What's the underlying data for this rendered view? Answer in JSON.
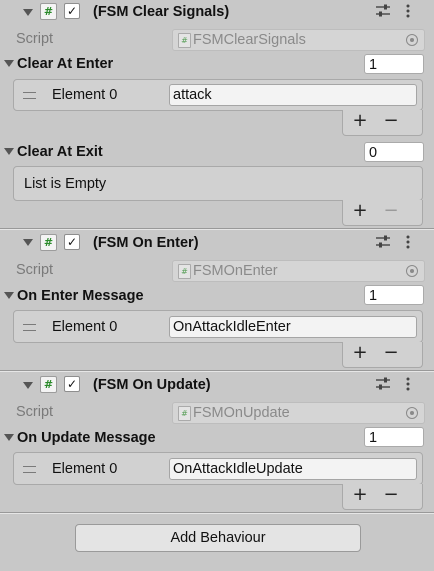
{
  "components": [
    {
      "title": "(FSM Clear Signals)",
      "script_label": "Script",
      "script_name": "FSMClearSignals",
      "lists": [
        {
          "label": "Clear At Enter",
          "size": "1",
          "elements": [
            {
              "label": "Element 0",
              "value": "attack"
            }
          ]
        },
        {
          "label": "Clear At Exit",
          "size": "0",
          "empty_text": "List is Empty",
          "elements": []
        }
      ]
    },
    {
      "title": "(FSM On Enter)",
      "script_label": "Script",
      "script_name": "FSMOnEnter",
      "lists": [
        {
          "label": "On Enter Message",
          "size": "1",
          "elements": [
            {
              "label": "Element 0",
              "value": "OnAttackIdleEnter"
            }
          ]
        }
      ]
    },
    {
      "title": "(FSM On Update)",
      "script_label": "Script",
      "script_name": "FSMOnUpdate",
      "lists": [
        {
          "label": "On Update Message",
          "size": "1",
          "elements": [
            {
              "label": "Element 0",
              "value": "OnAttackIdleUpdate"
            }
          ]
        }
      ]
    }
  ],
  "glyphs": {
    "hash": "#",
    "check": "✓",
    "plus": "+",
    "minus": "−"
  },
  "add_behaviour_label": "Add Behaviour",
  "colors": {
    "panel_bg": "#c8c8c8",
    "script_icon_green": "#2a8a2a"
  }
}
